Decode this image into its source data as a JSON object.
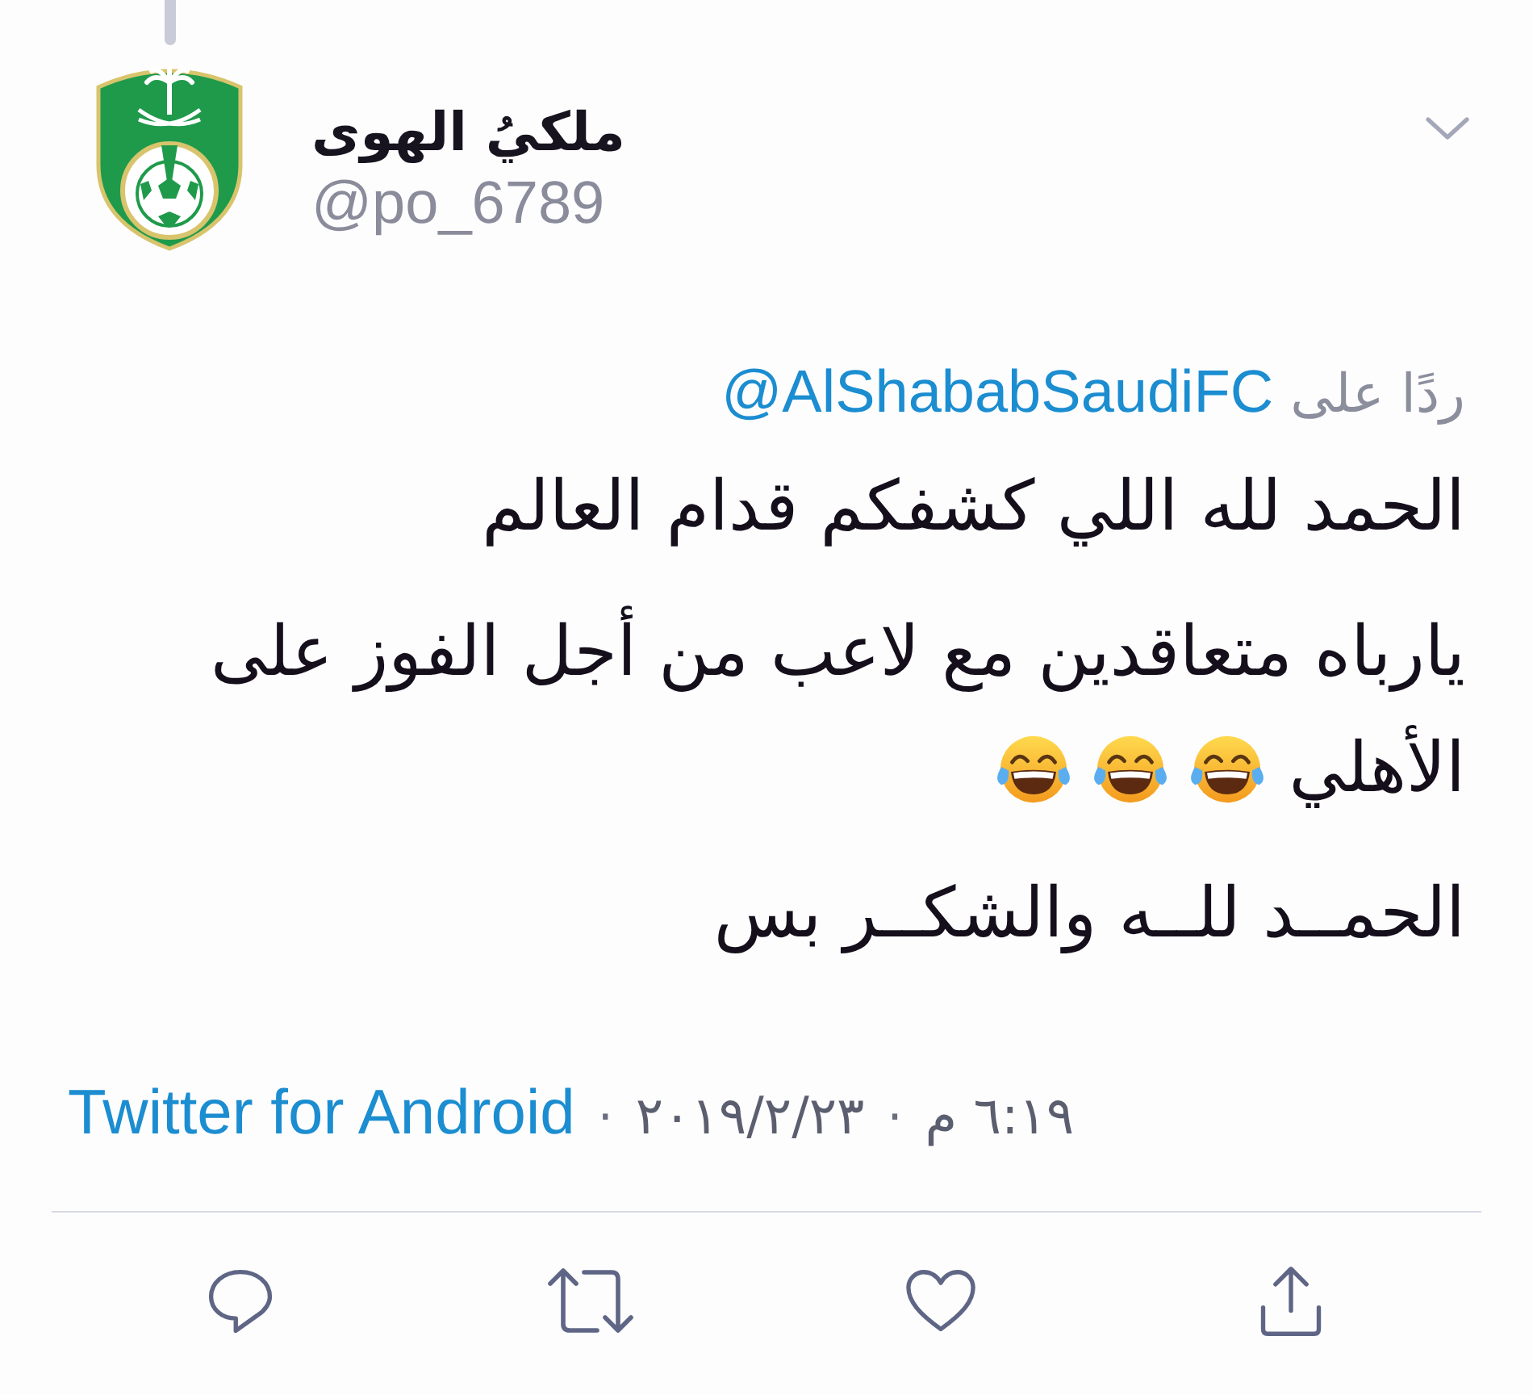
{
  "author": {
    "name": "ملكيُ الهوى",
    "handle": "@po_6789"
  },
  "reply_to": {
    "label": "ردًا على",
    "handle": "@AlShababSaudiFC"
  },
  "body": {
    "paragraphs": [
      {
        "lines": [
          {
            "text": "الحمد لله اللي كشفكم قدام العالم"
          }
        ]
      },
      {
        "lines": [
          {
            "text": "يارباه متعاقدين مع لاعب من أجل الفوز على"
          },
          {
            "text": "الأهلي",
            "emojis": [
              {
                "kind": "tears_of_joy"
              },
              {
                "kind": "tears_of_joy"
              },
              {
                "kind": "tears_of_joy"
              }
            ]
          }
        ]
      },
      {
        "lines": [
          {
            "text": "الحمــد للــه والشكــر بس"
          }
        ]
      }
    ]
  },
  "meta": [
    {
      "kind": "time",
      "text": "٦:١٩ م"
    },
    {
      "kind": "separator",
      "text": "·"
    },
    {
      "kind": "date",
      "text": "٢٠١٩/٢/٢٣"
    },
    {
      "kind": "separator",
      "text": "·"
    },
    {
      "kind": "source",
      "text": "Twitter for Android"
    }
  ]
}
